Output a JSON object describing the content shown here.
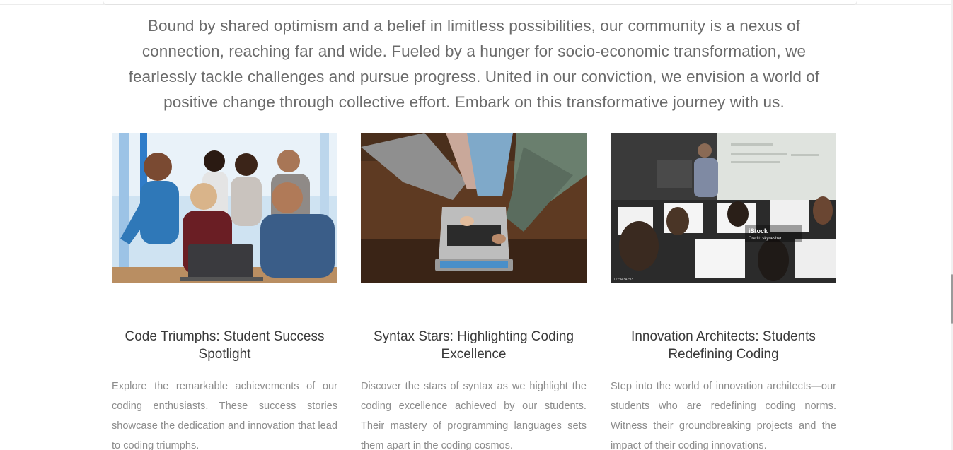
{
  "intro": {
    "text": "Bound by shared optimism and a belief in limitless possibilities, our community is a nexus of connection, reaching far and wide. Fueled by a hunger for socio-economic transformation, we fearlessly tackle challenges and pursue progress. United in our conviction, we envision a world of positive change through collective effort. Embark on this transformative journey with us."
  },
  "cards": [
    {
      "title": "Code Triumphs: Student Success Spotlight",
      "description": "Explore the remarkable achievements of our coding enthusiasts. These success stories showcase the dedication and innovation that lead to coding triumphs."
    },
    {
      "title": "Syntax Stars: Highlighting Coding Excellence",
      "description": "Discover the stars of syntax as we highlight the coding excellence achieved by our students. Their mastery of programming languages sets them apart in the coding cosmos."
    },
    {
      "title": "Innovation Architects: Students Redefining Coding",
      "description": "Step into the world of innovation architects—our students who are redefining coding norms. Witness their groundbreaking projects and the impact of their coding innovations.",
      "watermark": {
        "brand": "iStock",
        "credit": "Credit: skynesher",
        "stock_id": "1279434793"
      }
    }
  ]
}
